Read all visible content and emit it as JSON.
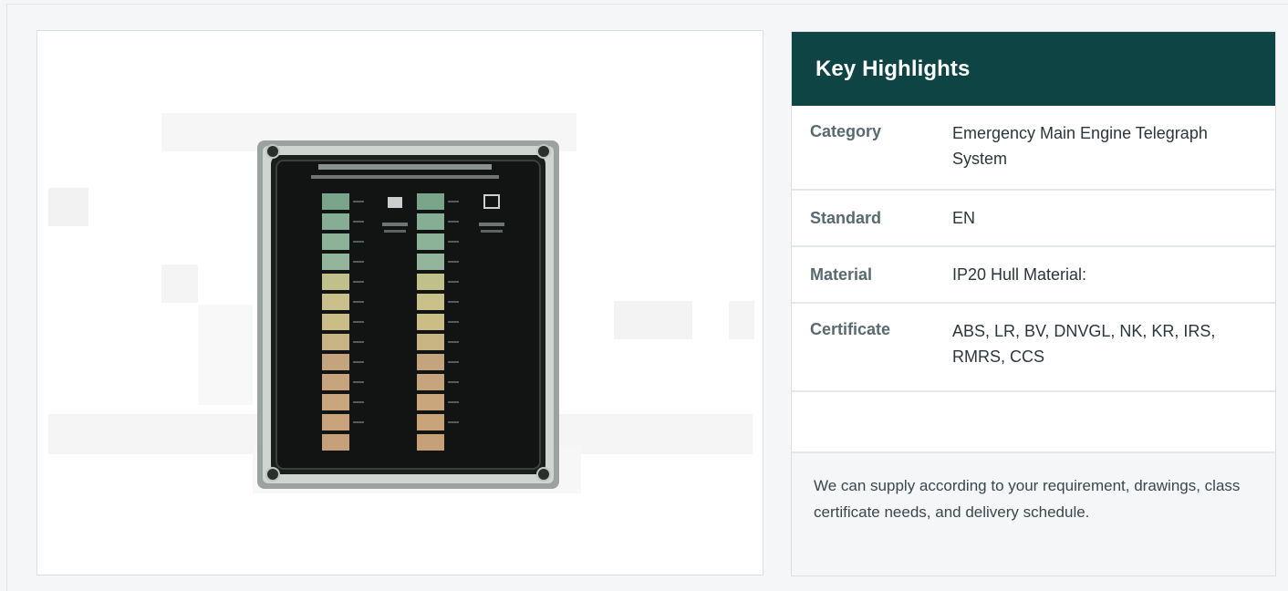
{
  "product_image": {
    "alt": "Emergency Main Engine Telegraph System panel"
  },
  "highlights": {
    "title": "Key Highlights",
    "rows": [
      {
        "key": "Category",
        "value": "Emergency Main Engine Telegraph System"
      },
      {
        "key": "Standard",
        "value": "EN"
      },
      {
        "key": "Material",
        "value": "IP20 Hull Material:"
      },
      {
        "key": "Certificate",
        "value": "ABS, LR, BV, DNVGL, NK, KR, IRS, RMRS, CCS"
      }
    ],
    "note": "We can supply according to your requirement, drawings, class certificate needs, and delivery schedule."
  },
  "colors": {
    "header_bg": "#0f4444",
    "panel_body": "#1b1f1c",
    "lamp_green": "#8fb39a",
    "lamp_yellow": "#c9be86",
    "lamp_orange": "#c7a27a"
  }
}
